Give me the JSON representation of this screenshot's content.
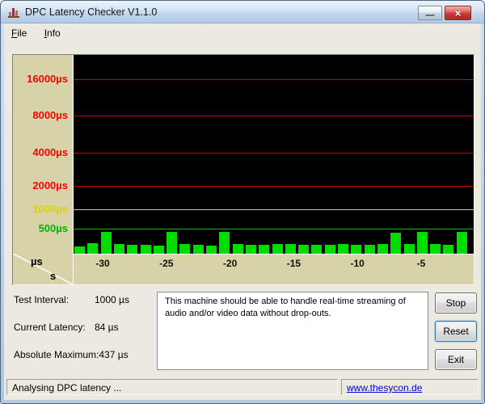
{
  "window": {
    "title": "DPC Latency Checker V1.1.0",
    "controls": {
      "minimize_icon": "—",
      "close_icon": "×"
    }
  },
  "menubar": {
    "items": [
      {
        "label": "File"
      },
      {
        "label": "Info"
      }
    ]
  },
  "chart_data": {
    "type": "bar",
    "title": "DPC latency over time",
    "plot_bg": "#000000",
    "axis_bg": "#d8d2a8",
    "bar_color": "#00dd00",
    "axis_corner": {
      "y_unit": "µs",
      "x_unit": "s"
    },
    "y_ticks": [
      {
        "value": 16000,
        "label": "16000µs",
        "label_color": "#ff0000",
        "line_color": "#d40000"
      },
      {
        "value": 8000,
        "label": "8000µs",
        "label_color": "#ff0000",
        "line_color": "#d40000"
      },
      {
        "value": 4000,
        "label": "4000µs",
        "label_color": "#ff0000",
        "line_color": "#d40000"
      },
      {
        "value": 2000,
        "label": "2000µs",
        "label_color": "#ff0000",
        "line_color": "#d40000"
      },
      {
        "value": 1000,
        "label": "1000µs",
        "label_color": "#ddd400",
        "line_color": "#e0d800"
      },
      {
        "value": 500,
        "label": "500µs",
        "label_color": "#00b400",
        "line_color": "#00c400"
      }
    ],
    "x_ticks": [
      "-30",
      "-25",
      "-20",
      "-15",
      "-10",
      "-5"
    ],
    "x_range_s": [
      -30,
      0
    ],
    "seconds_per_bar": 1,
    "values_us": [
      140,
      205,
      430,
      195,
      170,
      185,
      165,
      430,
      190,
      180,
      168,
      435,
      192,
      178,
      170,
      186,
      192,
      174,
      184,
      170,
      196,
      182,
      174,
      188,
      420,
      186,
      430,
      198,
      184,
      437
    ]
  },
  "stats": {
    "rows": [
      {
        "label": "Test Interval:",
        "value": "1000 µs"
      },
      {
        "label": "Current Latency:",
        "value": "84 µs"
      },
      {
        "label": "Absolute Maximum:",
        "value": "437 µs"
      }
    ]
  },
  "message": {
    "text": "This machine should be able to handle real-time streaming of audio and/or video data without drop-outs."
  },
  "actions": [
    {
      "label": "Stop"
    },
    {
      "label": "Reset"
    },
    {
      "label": "Exit"
    }
  ],
  "statusbar": {
    "text": "Analysing DPC latency ...",
    "link": "www.thesycon.de"
  }
}
